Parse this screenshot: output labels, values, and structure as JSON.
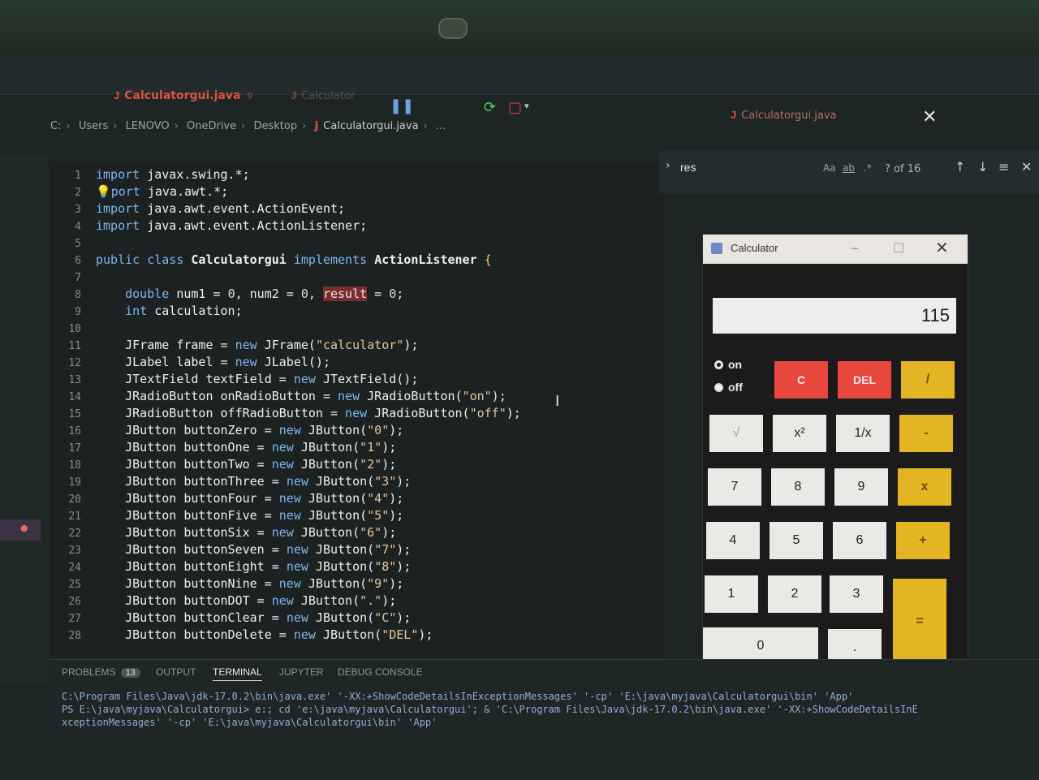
{
  "tabs": [
    {
      "label": "Calculatorgui.java",
      "badge": "9",
      "active": true
    },
    {
      "label": "Calculator",
      "badge": "",
      "active": false
    },
    {
      "label": "Calculatorgui.java",
      "badge": "",
      "active": false
    }
  ],
  "breadcrumb": [
    "C:",
    "Users",
    "LENOVO",
    "OneDrive",
    "Desktop",
    "Calculatorgui.java",
    "..."
  ],
  "find": {
    "query": "res",
    "match_case": "Aa",
    "whole_word": "ab",
    "regex": ".*",
    "count": "? of 16"
  },
  "code": [
    {
      "n": "1",
      "parts": [
        [
          "kw",
          "import"
        ],
        [
          "tx",
          " javax.swing.*;"
        ]
      ]
    },
    {
      "n": "2",
      "parts": [
        [
          "bulb",
          "💡"
        ],
        [
          "kw",
          "port"
        ],
        [
          "tx",
          " java.awt.*;"
        ]
      ]
    },
    {
      "n": "3",
      "parts": [
        [
          "kw",
          "import"
        ],
        [
          "tx",
          " java.awt.event.ActionEvent;"
        ]
      ]
    },
    {
      "n": "4",
      "parts": [
        [
          "kw",
          "import"
        ],
        [
          "tx",
          " java.awt.event.ActionListener;"
        ]
      ]
    },
    {
      "n": "5",
      "parts": []
    },
    {
      "n": "6",
      "parts": [
        [
          "kw",
          "public class "
        ],
        [
          "ty",
          "Calculatorgui "
        ],
        [
          "kw",
          "implements "
        ],
        [
          "ty",
          "ActionListener "
        ],
        [
          "pn",
          "{"
        ]
      ]
    },
    {
      "n": "7",
      "parts": []
    },
    {
      "n": "8",
      "parts": [
        [
          "tx",
          "    "
        ],
        [
          "kw",
          "double "
        ],
        [
          "tx",
          "num1 = "
        ],
        [
          "nm",
          "0"
        ],
        [
          "tx",
          ", num2 = "
        ],
        [
          "nm",
          "0"
        ],
        [
          "tx",
          ", "
        ],
        [
          "hl",
          "result"
        ],
        [
          "tx",
          " = "
        ],
        [
          "nm",
          "0"
        ],
        [
          "tx",
          ";"
        ]
      ]
    },
    {
      "n": "9",
      "parts": [
        [
          "tx",
          "    "
        ],
        [
          "kw",
          "int "
        ],
        [
          "tx",
          "calculation;"
        ]
      ]
    },
    {
      "n": "10",
      "parts": []
    },
    {
      "n": "11",
      "parts": [
        [
          "tx",
          "    JFrame frame = "
        ],
        [
          "kw",
          "new "
        ],
        [
          "tx",
          "JFrame("
        ],
        [
          "st",
          "\"calculator\""
        ],
        [
          "tx",
          ");"
        ]
      ]
    },
    {
      "n": "12",
      "parts": [
        [
          "tx",
          "    JLabel label = "
        ],
        [
          "kw",
          "new "
        ],
        [
          "tx",
          "JLabel();"
        ]
      ]
    },
    {
      "n": "13",
      "parts": [
        [
          "tx",
          "    JTextField textField = "
        ],
        [
          "kw",
          "new "
        ],
        [
          "tx",
          "JTextField();"
        ]
      ]
    },
    {
      "n": "14",
      "parts": [
        [
          "tx",
          "    JRadioButton onRadioButton = "
        ],
        [
          "kw",
          "new "
        ],
        [
          "tx",
          "JRadioButton("
        ],
        [
          "st",
          "\"on\""
        ],
        [
          "tx",
          ");"
        ]
      ]
    },
    {
      "n": "15",
      "parts": [
        [
          "tx",
          "    JRadioButton offRadioButton = "
        ],
        [
          "kw",
          "new "
        ],
        [
          "tx",
          "JRadioButton("
        ],
        [
          "st",
          "\"off\""
        ],
        [
          "tx",
          ");"
        ]
      ]
    },
    {
      "n": "16",
      "parts": [
        [
          "tx",
          "    JButton buttonZero = "
        ],
        [
          "kw",
          "new "
        ],
        [
          "tx",
          "JButton("
        ],
        [
          "st",
          "\"0\""
        ],
        [
          "tx",
          ");"
        ]
      ]
    },
    {
      "n": "17",
      "parts": [
        [
          "tx",
          "    JButton buttonOne = "
        ],
        [
          "kw",
          "new "
        ],
        [
          "tx",
          "JButton("
        ],
        [
          "st",
          "\"1\""
        ],
        [
          "tx",
          ");"
        ]
      ]
    },
    {
      "n": "18",
      "parts": [
        [
          "tx",
          "    JButton buttonTwo = "
        ],
        [
          "kw",
          "new "
        ],
        [
          "tx",
          "JButton("
        ],
        [
          "st",
          "\"2\""
        ],
        [
          "tx",
          ");"
        ]
      ]
    },
    {
      "n": "19",
      "parts": [
        [
          "tx",
          "    JButton buttonThree = "
        ],
        [
          "kw",
          "new "
        ],
        [
          "tx",
          "JButton("
        ],
        [
          "st",
          "\"3\""
        ],
        [
          "tx",
          ");"
        ]
      ]
    },
    {
      "n": "20",
      "parts": [
        [
          "tx",
          "    JButton buttonFour = "
        ],
        [
          "kw",
          "new "
        ],
        [
          "tx",
          "JButton("
        ],
        [
          "st",
          "\"4\""
        ],
        [
          "tx",
          ");"
        ]
      ]
    },
    {
      "n": "21",
      "parts": [
        [
          "tx",
          "    JButton buttonFive = "
        ],
        [
          "kw",
          "new "
        ],
        [
          "tx",
          "JButton("
        ],
        [
          "st",
          "\"5\""
        ],
        [
          "tx",
          ");"
        ]
      ]
    },
    {
      "n": "22",
      "parts": [
        [
          "tx",
          "    JButton buttonSix = "
        ],
        [
          "kw",
          "new "
        ],
        [
          "tx",
          "JButton("
        ],
        [
          "st",
          "\"6\""
        ],
        [
          "tx",
          ");"
        ]
      ]
    },
    {
      "n": "23",
      "parts": [
        [
          "tx",
          "    JButton buttonSeven = "
        ],
        [
          "kw",
          "new "
        ],
        [
          "tx",
          "JButton("
        ],
        [
          "st",
          "\"7\""
        ],
        [
          "tx",
          ");"
        ]
      ]
    },
    {
      "n": "24",
      "parts": [
        [
          "tx",
          "    JButton buttonEight = "
        ],
        [
          "kw",
          "new "
        ],
        [
          "tx",
          "JButton("
        ],
        [
          "st",
          "\"8\""
        ],
        [
          "tx",
          ");"
        ]
      ]
    },
    {
      "n": "25",
      "parts": [
        [
          "tx",
          "    JButton buttonNine = "
        ],
        [
          "kw",
          "new "
        ],
        [
          "tx",
          "JButton("
        ],
        [
          "st",
          "\"9\""
        ],
        [
          "tx",
          ");"
        ]
      ]
    },
    {
      "n": "26",
      "parts": [
        [
          "tx",
          "    JButton buttonDOT = "
        ],
        [
          "kw",
          "new "
        ],
        [
          "tx",
          "JButton("
        ],
        [
          "st",
          "\".\""
        ],
        [
          "tx",
          ");"
        ]
      ]
    },
    {
      "n": "27",
      "parts": [
        [
          "tx",
          "    JButton buttonClear = "
        ],
        [
          "kw",
          "new "
        ],
        [
          "tx",
          "JButton("
        ],
        [
          "st",
          "\"C\""
        ],
        [
          "tx",
          ");"
        ]
      ]
    },
    {
      "n": "28",
      "parts": [
        [
          "tx",
          "    JButton buttonDelete = "
        ],
        [
          "kw",
          "new "
        ],
        [
          "tx",
          "JButton("
        ],
        [
          "st",
          "\"DEL\""
        ],
        [
          "tx",
          ");"
        ]
      ]
    }
  ],
  "calculator": {
    "title": "Calculator",
    "display": "115",
    "radio_on": "on",
    "radio_off": "off",
    "buttons": {
      "clear": "C",
      "delete": "DEL",
      "divide": "/",
      "sqrt": "√",
      "square": "x²",
      "reciprocal": "1/x",
      "subtract": "-",
      "seven": "7",
      "eight": "8",
      "nine": "9",
      "multiply": "x",
      "four": "4",
      "five": "5",
      "six": "6",
      "add": "+",
      "one": "1",
      "two": "2",
      "three": "3",
      "equals": "=",
      "zero": "0",
      "dot": "."
    }
  },
  "panel": {
    "tabs": [
      "PROBLEMS",
      "OUTPUT",
      "TERMINAL",
      "JUPYTER",
      "DEBUG CONSOLE"
    ],
    "problems_count": "13",
    "terminal": [
      "C:\\Program Files\\Java\\jdk-17.0.2\\bin\\java.exe' '-XX:+ShowCodeDetailsInExceptionMessages' '-cp' 'E:\\java\\myjava\\Calculatorgui\\bin' 'App'",
      "PS E:\\java\\myjava\\Calculatorgui> e:; cd 'e:\\java\\myjava\\Calculatorgui'; & 'C:\\Program Files\\Java\\jdk-17.0.2\\bin\\java.exe' '-XX:+ShowCodeDetailsInE",
      "xceptionMessages' '-cp' 'E:\\java\\myjava\\Calculatorgui\\bin' 'App'"
    ]
  }
}
